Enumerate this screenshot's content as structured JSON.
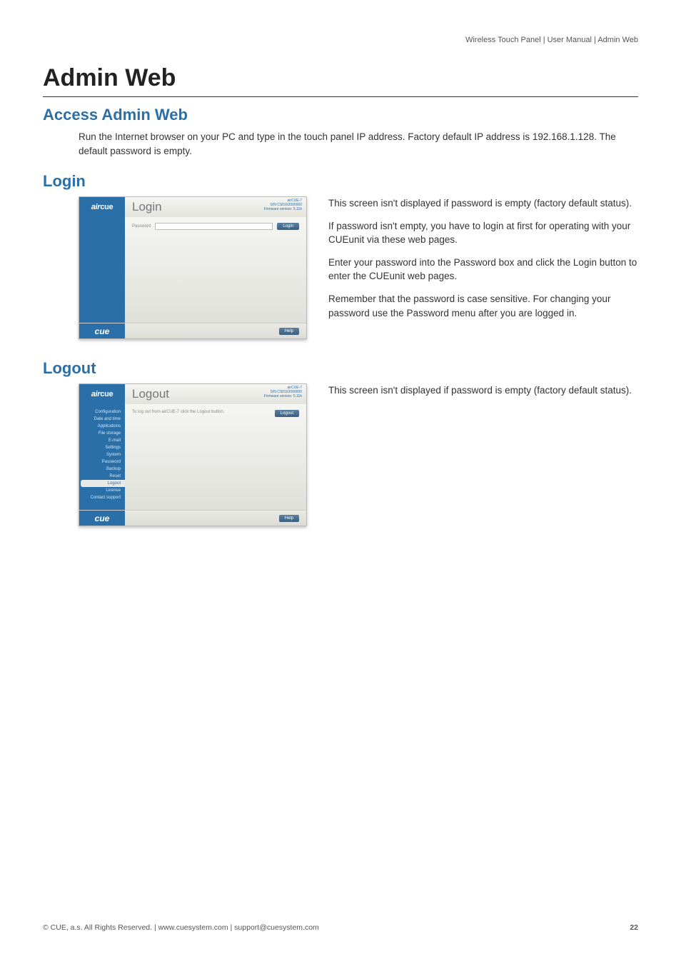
{
  "breadcrumb": "Wireless Touch Panel  |  User Manual  |  Admin Web",
  "h1": "Admin Web",
  "access": {
    "heading": "Access Admin Web",
    "text": "Run the Internet browser on your PC and type in the touch panel IP address. Factory default IP address is 192.168.1.128. The default password is empty."
  },
  "login": {
    "heading": "Login",
    "window": {
      "brand": "aircue",
      "title": "Login",
      "meta_line1": "airCUE-7",
      "meta_line2": "S/N CS0162000000",
      "meta_line3": "Firmware version: 5.11b",
      "password_label": "Password",
      "login_btn": "Login",
      "help_btn": "Help",
      "cue": "cue"
    },
    "paragraphs": [
      "This screen isn't displayed if password is empty (factory default status).",
      "If password isn't empty, you have to login at first for operating with your CUEunit via these web pages.",
      "Enter your password into the Password box and click the Login button to enter the CUEunit web pages.",
      "Remember that the password is case sensitive. For changing your password use the Password menu after you are logged in."
    ]
  },
  "logout": {
    "heading": "Logout",
    "window": {
      "brand": "aircue",
      "title": "Logout",
      "meta_line1": "airCUE-7",
      "meta_line2": "S/N CS0162000000",
      "meta_line3": "Firmware version: 5.11b",
      "body_text": "To log out from airCUE-7 click the Logout button.",
      "logout_btn": "Logout",
      "help_btn": "Help",
      "cue": "cue",
      "nav": [
        "Configuration",
        "Date and time",
        "Applications",
        "File storage",
        "E-mail",
        "Settings",
        "System",
        "Password",
        "Backup",
        "Reset",
        "Logout",
        "License",
        "Contact support"
      ],
      "active_index": 10
    },
    "paragraphs": [
      "This screen isn't displayed if password is empty (factory default status)."
    ]
  },
  "footer": {
    "left": "© CUE, a.s. All Rights Reserved. | www.cuesystem.com | support@cuesystem.com",
    "page": "22"
  }
}
